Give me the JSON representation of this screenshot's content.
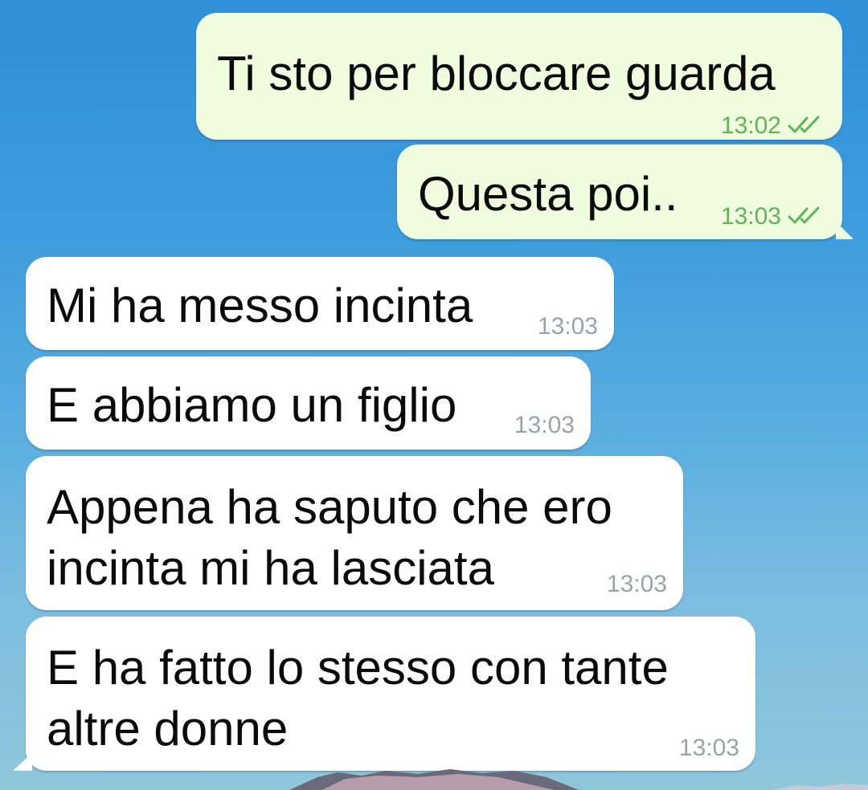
{
  "messages": [
    {
      "direction": "outgoing",
      "text": "Ti sto per bloccare guarda",
      "time": "13:02",
      "status": "read"
    },
    {
      "direction": "outgoing",
      "text": "Questa poi..",
      "time": "13:03",
      "status": "read"
    },
    {
      "direction": "incoming",
      "text": "Mi ha messo incinta",
      "time": "13:03"
    },
    {
      "direction": "incoming",
      "text": "E abbiamo un figlio",
      "time": "13:03"
    },
    {
      "direction": "incoming",
      "lines": [
        "Appena ha saputo che ero",
        "incinta mi ha lasciata"
      ],
      "time": "13:03"
    },
    {
      "direction": "incoming",
      "lines": [
        "E ha fatto lo stesso con tante",
        "altre donne"
      ],
      "time": "13:03"
    }
  ],
  "icons": {
    "read_receipt": "double-check-icon"
  },
  "colors": {
    "outgoing_bubble": "#effdde",
    "incoming_bubble": "#ffffff",
    "outgoing_meta": "#5fb556",
    "incoming_meta": "#9aa3ab",
    "wallpaper_top": "#2f8fd8",
    "wallpaper_bottom": "#8fc6dc"
  }
}
